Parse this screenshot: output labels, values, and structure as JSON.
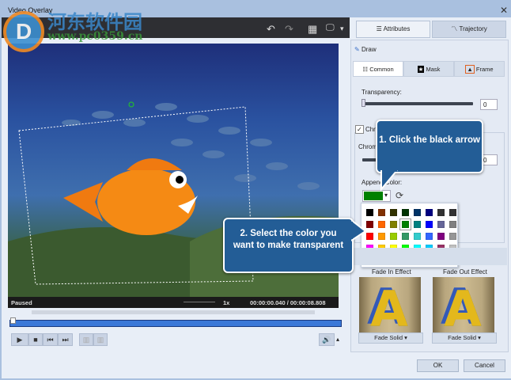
{
  "window": {
    "title": "Video Overlay",
    "close": "✕"
  },
  "watermark": {
    "text": "河东软件园",
    "url": "www.pc0359.cn"
  },
  "toolbar": {
    "undo": "↶",
    "redo": "↷",
    "grid": "▦",
    "display": "🖵",
    "dropdown": "▾"
  },
  "player": {
    "status": "Paused",
    "speed": "1x",
    "time": "00:00:00.040 / 00:00:08.808",
    "progress": 0.005
  },
  "tabs": [
    {
      "label": "Attributes"
    },
    {
      "label": "Trajectory"
    }
  ],
  "draw": {
    "label": "Draw"
  },
  "subtabs": [
    {
      "label": "Common"
    },
    {
      "label": "Mask"
    },
    {
      "label": "Frame"
    }
  ],
  "transparency": {
    "label": "Transparency:",
    "value": "0",
    "fraction": 0
  },
  "chroma": {
    "checkbox_label": "Chroma",
    "checked": true,
    "label": "Chroma",
    "value": "0"
  },
  "append_color": {
    "label": "Append Color:",
    "selected": "#008000"
  },
  "palette": [
    "#000000",
    "#803000",
    "#333300",
    "#003300",
    "#003366",
    "#000080",
    "#333333",
    "#333333",
    "#800000",
    "#ff6600",
    "#808000",
    "#008000",
    "#008080",
    "#0000ff",
    "#666699",
    "#808080",
    "#ff0000",
    "#ff9900",
    "#99cc00",
    "#339966",
    "#33cccc",
    "#3366ff",
    "#800080",
    "#969696",
    "#ff00ff",
    "#ffcc00",
    "#ffff00",
    "#00ff00",
    "#00ffff",
    "#00ccff",
    "#993366",
    "#c0c0c0",
    "#ff99cc",
    "#ffcc99",
    "#ffff99",
    "#ccffcc",
    "#ccffff",
    "#99ccff",
    "#cc99ff"
  ],
  "callouts": {
    "one": "1. Click the black arrow",
    "two": "2. Select the color you want to make transparent"
  },
  "fade": {
    "in_label": "Fade In Effect",
    "out_label": "Fade Out Effect",
    "in_value": "Fade Solid",
    "out_value": "Fade Solid",
    "preview_letter": "A"
  },
  "buttons": {
    "ok": "OK",
    "cancel": "Cancel"
  }
}
